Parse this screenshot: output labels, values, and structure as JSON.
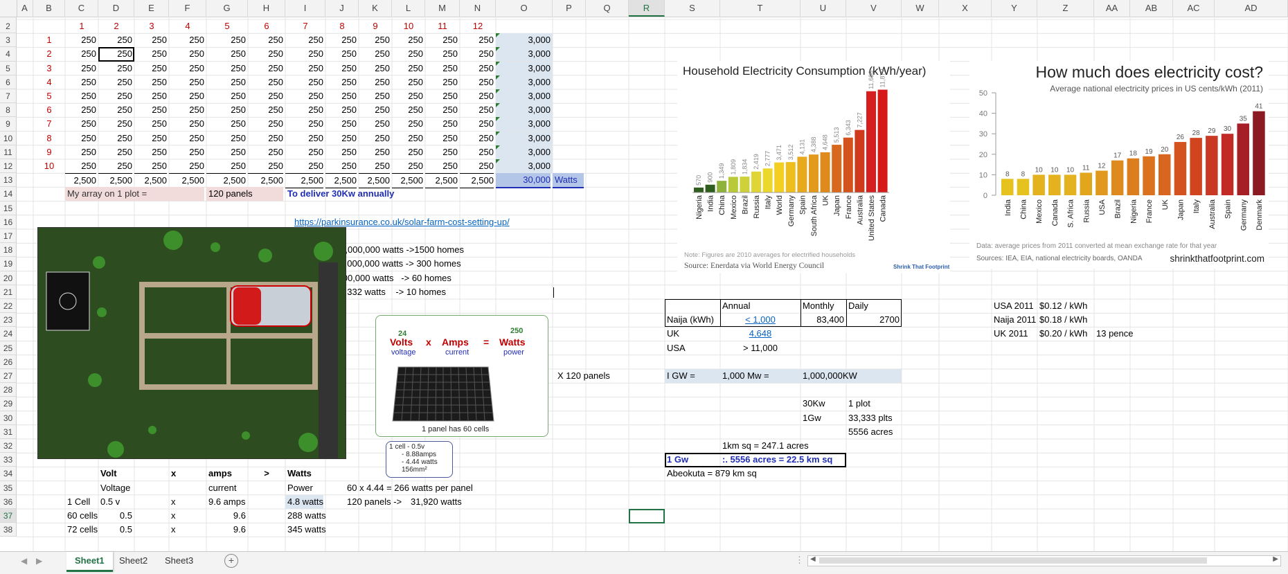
{
  "columns": [
    "A",
    "B",
    "C",
    "D",
    "E",
    "F",
    "G",
    "H",
    "I",
    "J",
    "K",
    "L",
    "M",
    "N",
    "O",
    "P",
    "Q",
    "R",
    "S",
    "T",
    "U",
    "V",
    "W",
    "X",
    "Y",
    "Z",
    "AA",
    "AB",
    "AC",
    "AD"
  ],
  "selected_column": "R",
  "rows": [
    "1",
    "2",
    "3",
    "4",
    "5",
    "6",
    "7",
    "8",
    "9",
    "10",
    "11",
    "12",
    "13",
    "14",
    "15",
    "16",
    "17",
    "18",
    "19",
    "20",
    "21",
    "22",
    "23",
    "24",
    "25",
    "26",
    "27",
    "28",
    "29",
    "30",
    "31",
    "32",
    "33",
    "34",
    "35",
    "36",
    "37",
    "38"
  ],
  "selected_row": "37",
  "months": [
    "1",
    "2",
    "3",
    "4",
    "5",
    "6",
    "7",
    "8",
    "9",
    "10",
    "11",
    "12"
  ],
  "panel_rows": [
    {
      "n": "1",
      "vals": [
        "250",
        "250",
        "250",
        "250",
        "250",
        "250",
        "250",
        "250",
        "250",
        "250",
        "250",
        "250"
      ],
      "total": "3,000"
    },
    {
      "n": "2",
      "vals": [
        "250",
        "250",
        "250",
        "250",
        "250",
        "250",
        "250",
        "250",
        "250",
        "250",
        "250",
        "250"
      ],
      "total": "3,000"
    },
    {
      "n": "3",
      "vals": [
        "250",
        "250",
        "250",
        "250",
        "250",
        "250",
        "250",
        "250",
        "250",
        "250",
        "250",
        "250"
      ],
      "total": "3,000"
    },
    {
      "n": "4",
      "vals": [
        "250",
        "250",
        "250",
        "250",
        "250",
        "250",
        "250",
        "250",
        "250",
        "250",
        "250",
        "250"
      ],
      "total": "3,000"
    },
    {
      "n": "5",
      "vals": [
        "250",
        "250",
        "250",
        "250",
        "250",
        "250",
        "250",
        "250",
        "250",
        "250",
        "250",
        "250"
      ],
      "total": "3,000"
    },
    {
      "n": "6",
      "vals": [
        "250",
        "250",
        "250",
        "250",
        "250",
        "250",
        "250",
        "250",
        "250",
        "250",
        "250",
        "250"
      ],
      "total": "3,000"
    },
    {
      "n": "7",
      "vals": [
        "250",
        "250",
        "250",
        "250",
        "250",
        "250",
        "250",
        "250",
        "250",
        "250",
        "250",
        "250"
      ],
      "total": "3,000"
    },
    {
      "n": "8",
      "vals": [
        "250",
        "250",
        "250",
        "250",
        "250",
        "250",
        "250",
        "250",
        "250",
        "250",
        "250",
        "250"
      ],
      "total": "3,000"
    },
    {
      "n": "9",
      "vals": [
        "250",
        "250",
        "250",
        "250",
        "250",
        "250",
        "250",
        "250",
        "250",
        "250",
        "250",
        "250"
      ],
      "total": "3,000"
    },
    {
      "n": "10",
      "vals": [
        "250",
        "250",
        "250",
        "250",
        "250",
        "250",
        "250",
        "250",
        "250",
        "250",
        "250",
        "250"
      ],
      "total": "3,000"
    }
  ],
  "column_totals": [
    "2,500",
    "2,500",
    "2,500",
    "2,500",
    "2,500",
    "2,500",
    "2,500",
    "2,500",
    "2,500",
    "2,500",
    "2,500",
    "2,500"
  ],
  "grand_total": "30,000",
  "grand_total_unit": "Watts",
  "array_label": "My array on 1 plot =",
  "array_value": "120 panels",
  "deliver_note": "To deliver 30Kw annually",
  "link_url": "https://parkinsurance.co.uk/solar-farm-cost-setting-up/",
  "land_notes": [
    "25 Acres-> 5,000,000 watts ->1500 homes",
    "5 acres  -> 1,000,000 watts -> 300 homes",
    "1 acre   -> 200,000 watts   -> 60 homes",
    "1 plot   -> 33,332 watts    -> 10 homes"
  ],
  "formula": {
    "volts": "Volts",
    "x": "x",
    "amps": "Amps",
    "eq": "=",
    "watts": "Watts",
    "voltage": "voltage",
    "current": "current",
    "power": "power",
    "v_val": "24",
    "w_val": "250",
    "panel_caption": "1 panel has 60 cells"
  },
  "cell_note": [
    "1 cell - 0.5v",
    "- 8.88amps",
    "- 4.44 watts",
    "156mm²"
  ],
  "calc_headers": {
    "volt": "Volt",
    "x": "x",
    "amps": "amps",
    "gt": ">",
    "watts": "Watts"
  },
  "calc_sub": {
    "voltage": "Voltage",
    "current": "current",
    "power": "Power"
  },
  "calc_rows": [
    {
      "label": "1 Cell",
      "v": "0.5 v",
      "x": "x",
      "a": "9.6 amps",
      "w": "4.8 watts"
    },
    {
      "label": "60 cells",
      "v": "0.5",
      "x": "x",
      "a": "9.6",
      "w": "288 watts"
    },
    {
      "label": "72 cells",
      "v": "0.5",
      "x": "x",
      "a": "9.6",
      "w": "345 watts"
    }
  ],
  "panel_calc": [
    "60 x 4.44 = 266 watts per panel",
    "120 panels ->",
    "31,920 watts"
  ],
  "x_panels": "X 120 panels",
  "consumption_table": {
    "headers": [
      "",
      "Annual",
      "Monthly",
      "Daily"
    ],
    "rows": [
      {
        "c": "Naija (kWh)",
        "a": "< 1,000",
        "m": "83,400",
        "d": "2700"
      },
      {
        "c": "UK",
        "a": "4,648",
        "m": "",
        "d": ""
      },
      {
        "c": "USA",
        "a": "> 11,000",
        "m": "",
        "d": ""
      }
    ]
  },
  "gw_row": [
    "I GW =",
    "1,000 Mw =",
    "1,000,000KW"
  ],
  "plots": [
    [
      "30Kw",
      "1 plot"
    ],
    [
      "1Gw",
      "33,333 plts"
    ],
    [
      "",
      "5556 acres"
    ]
  ],
  "km_note": "1km sq = 247.1 acres",
  "gw_summary": [
    "1 Gw",
    ":. 5556 acres = 22.5 km sq"
  ],
  "abeokuta": "Abeokuta =  879 km sq",
  "prices": [
    {
      "c": "USA 2011",
      "p": "$0.12 / kWh",
      "x": ""
    },
    {
      "c": "Naija 2011",
      "p": "$0.18 / kWh",
      "x": ""
    },
    {
      "c": "UK 2011",
      "p": "$0.20 / kWh",
      "x": "13 pence"
    }
  ],
  "chart_data": [
    {
      "type": "bar",
      "title": "Household Electricity Consumption (kWh/year)",
      "categories": [
        "Nigeria",
        "India",
        "China",
        "Mexico",
        "Brazil",
        "Russia",
        "Italy",
        "World",
        "Germany",
        "Spain",
        "South Africa",
        "UK",
        "Japan",
        "France",
        "Australia",
        "United States",
        "Canada"
      ],
      "values": [
        570,
        900,
        1349,
        1809,
        1834,
        2419,
        2777,
        3471,
        3512,
        4131,
        4388,
        4648,
        5513,
        6343,
        7227,
        11698,
        11879
      ],
      "value_labels": [
        "570",
        "900",
        "1,349",
        "1,809",
        "1,834",
        "2,419",
        "2,777",
        "3,471",
        "3,512",
        "4,131",
        "4,388",
        "4,648",
        "5,513",
        "6,343",
        "7,227",
        "11,698",
        "11,879"
      ],
      "colors": [
        "#2f5d1e",
        "#2f5d1e",
        "#8fb33a",
        "#b8c93a",
        "#cfd13a",
        "#e0d534",
        "#ecd82c",
        "#f2cf22",
        "#eebe1c",
        "#e8aa1c",
        "#e39a1c",
        "#de8a1c",
        "#d8691c",
        "#d4531c",
        "#cf3a1c",
        "#d62020",
        "#d61a1a"
      ],
      "note": "Note: Figures are 2010 averages for electrified households",
      "source": "Source:  Enerdata via World Energy Council",
      "brand": "Shrink That Footprint",
      "grid": false
    },
    {
      "type": "bar",
      "title": "How much does electricity cost?",
      "subtitle": "Average national electricity prices in US cents/kWh (2011)",
      "categories": [
        "India",
        "China",
        "Mexico",
        "Canada",
        "S. Africa",
        "Russia",
        "USA",
        "Brazil",
        "Nigeria",
        "France",
        "UK",
        "Japan",
        "Italy",
        "Australia",
        "Spain",
        "Germany",
        "Denmark"
      ],
      "values": [
        8,
        8,
        10,
        10,
        10,
        11,
        12,
        17,
        18,
        19,
        20,
        26,
        28,
        29,
        30,
        35,
        41
      ],
      "ylim": [
        0,
        50
      ],
      "yticks": [
        "0",
        "10",
        "20",
        "30",
        "40",
        "50"
      ],
      "colors": [
        "#e6c21e",
        "#e6c21e",
        "#e4b21e",
        "#e4b21e",
        "#e4b21e",
        "#e2a51e",
        "#e0991e",
        "#de8a1e",
        "#dc7d1e",
        "#da721e",
        "#d8661e",
        "#d4521e",
        "#d0441e",
        "#c93822",
        "#c22a26",
        "#a61e26",
        "#8c1a22"
      ],
      "data_note": "Data:  average prices from 2011 converted at mean exchange rate for that year",
      "sources": "Sources: IEA, EIA, national electricity boards, OANDA",
      "brand": "shrinkthatfootprint.com",
      "grid": false
    }
  ],
  "sheet_tabs": [
    "Sheet1",
    "Sheet2",
    "Sheet3"
  ],
  "active_tab": "Sheet1",
  "add_sheet": "+"
}
